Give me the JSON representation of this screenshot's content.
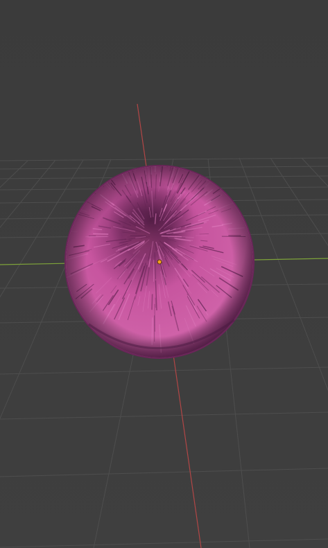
{
  "viewport": {
    "background": "#3d3d3d",
    "grid_color": "#525252",
    "x_axis_color": "#8bbf3a",
    "y_axis_color": "#c04545"
  },
  "object": {
    "icon": "fur-sphere-icon",
    "base_color": "#c7559f",
    "shadow_color": "#5e2150",
    "highlight_color": "#de7bbd",
    "origin_color": "#f5a020"
  }
}
